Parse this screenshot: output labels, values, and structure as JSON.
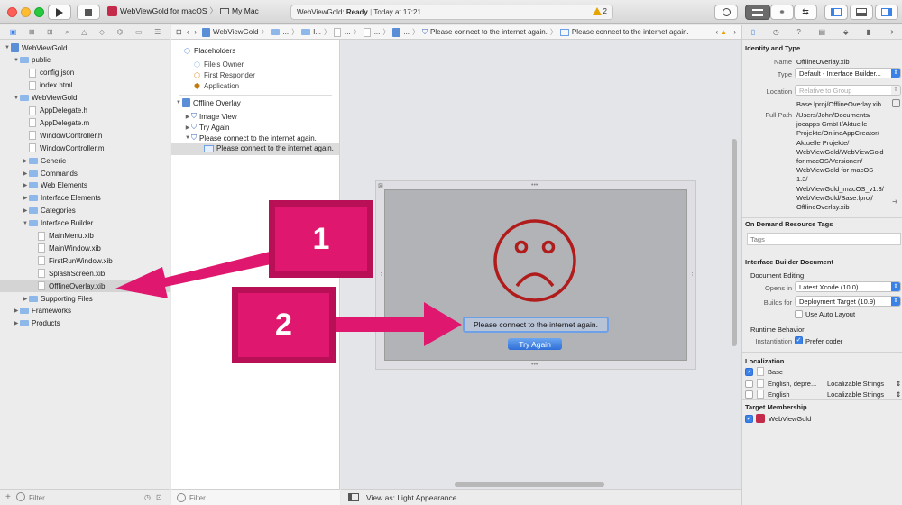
{
  "titlebar": {
    "scheme_project": "WebViewGold for macOS",
    "scheme_target": "My Mac",
    "status_app": "WebViewGold:",
    "status_state": "Ready",
    "status_time": "Today at 17:21",
    "warning_count": "2"
  },
  "navigator": {
    "filter_placeholder": "Filter",
    "items": [
      {
        "label": "WebViewGold",
        "kind": "project",
        "indent": 0,
        "disclosure": "open"
      },
      {
        "label": "public",
        "kind": "folder",
        "indent": 1,
        "disclosure": "open"
      },
      {
        "label": "config.json",
        "kind": "file",
        "indent": 2,
        "disclosure": ""
      },
      {
        "label": "index.html",
        "kind": "file",
        "indent": 2,
        "disclosure": ""
      },
      {
        "label": "WebViewGold",
        "kind": "folder",
        "indent": 1,
        "disclosure": "open"
      },
      {
        "label": "AppDelegate.h",
        "kind": "file",
        "indent": 2,
        "disclosure": ""
      },
      {
        "label": "AppDelegate.m",
        "kind": "file",
        "indent": 2,
        "disclosure": ""
      },
      {
        "label": "WindowController.h",
        "kind": "file",
        "indent": 2,
        "disclosure": ""
      },
      {
        "label": "WindowController.m",
        "kind": "file",
        "indent": 2,
        "disclosure": ""
      },
      {
        "label": "Generic",
        "kind": "folder",
        "indent": 2,
        "disclosure": "closed"
      },
      {
        "label": "Commands",
        "kind": "folder",
        "indent": 2,
        "disclosure": "closed"
      },
      {
        "label": "Web Elements",
        "kind": "folder",
        "indent": 2,
        "disclosure": "closed"
      },
      {
        "label": "Interface Elements",
        "kind": "folder",
        "indent": 2,
        "disclosure": "closed"
      },
      {
        "label": "Categories",
        "kind": "folder",
        "indent": 2,
        "disclosure": "closed"
      },
      {
        "label": "Interface Builder",
        "kind": "folder",
        "indent": 2,
        "disclosure": "open"
      },
      {
        "label": "MainMenu.xib",
        "kind": "file",
        "indent": 3,
        "disclosure": ""
      },
      {
        "label": "MainWindow.xib",
        "kind": "file",
        "indent": 3,
        "disclosure": ""
      },
      {
        "label": "FirstRunWindow.xib",
        "kind": "file",
        "indent": 3,
        "disclosure": ""
      },
      {
        "label": "SplashScreen.xib",
        "kind": "file",
        "indent": 3,
        "disclosure": ""
      },
      {
        "label": "OfflineOverlay.xib",
        "kind": "file",
        "indent": 3,
        "disclosure": "",
        "selected": true
      },
      {
        "label": "Supporting Files",
        "kind": "folder",
        "indent": 2,
        "disclosure": "closed"
      },
      {
        "label": "Frameworks",
        "kind": "folder",
        "indent": 1,
        "disclosure": "closed"
      },
      {
        "label": "Products",
        "kind": "folder",
        "indent": 1,
        "disclosure": "closed"
      }
    ]
  },
  "jumpbar": {
    "project": "WebViewGold",
    "ellipsis": "...",
    "folder_short": "I...",
    "item_view": "Please connect to the internet again.",
    "item_cell": "Please connect to the internet again."
  },
  "outline": {
    "placeholders_header": "Placeholders",
    "files_owner": "File's Owner",
    "first_responder": "First Responder",
    "application": "Application",
    "root_view": "Offline Overlay",
    "image_view": "Image View",
    "try_again": "Try Again",
    "text_field": "Please connect to the internet again.",
    "text_field_cell": "Please connect to the internet again.",
    "filter_placeholder": "Filter"
  },
  "canvas": {
    "message": "Please connect to the internet again.",
    "button": "Try Again",
    "view_as": "View as: Light Appearance"
  },
  "inspector": {
    "identity_type_header": "Identity and Type",
    "name_label": "Name",
    "name_value": "OfflineOverlay.xib",
    "type_label": "Type",
    "type_value": "Default - Interface Builder...",
    "location_label": "Location",
    "location_value": "Relative to Group",
    "location_path": "Base.lproj/OfflineOverlay.xib",
    "fullpath_label": "Full Path",
    "fullpath_lines": [
      "/Users/John/Documents/",
      "jocapps GmbH/Aktuelle",
      "Projekte/OnlineAppCreator/",
      "Aktuelle Projekte/",
      "WebViewGold/WebViewGold",
      "for macOS/Versionen/",
      "WebViewGold for macOS",
      "1.3/",
      "WebViewGold_macOS_v1.3/",
      "WebViewGold/Base.lproj/",
      "OfflineOverlay.xib"
    ],
    "odr_header": "On Demand Resource Tags",
    "tags_placeholder": "Tags",
    "ib_doc_header": "Interface Builder Document",
    "doc_editing": "Document Editing",
    "opens_in_label": "Opens in",
    "opens_in_value": "Latest Xcode (10.0)",
    "builds_for_label": "Builds for",
    "builds_for_value": "Deployment Target (10.9)",
    "auto_layout": "Use Auto Layout",
    "runtime_behavior": "Runtime Behavior",
    "instantiation_label": "Instantiation",
    "prefer_coder": "Prefer coder",
    "localization_header": "Localization",
    "loc_rows": [
      {
        "lang": "Base",
        "kind": "",
        "checked": true
      },
      {
        "lang": "English, depre...",
        "kind": "Localizable Strings",
        "checked": false
      },
      {
        "lang": "English",
        "kind": "Localizable Strings",
        "checked": false
      }
    ],
    "target_header": "Target Membership",
    "target_name": "WebViewGold"
  },
  "annotations": {
    "badge1": "1",
    "badge2": "2"
  },
  "colors": {
    "accent": "#3b82e6",
    "annotation": "#e0176e",
    "sad_face": "#b01c1c"
  }
}
